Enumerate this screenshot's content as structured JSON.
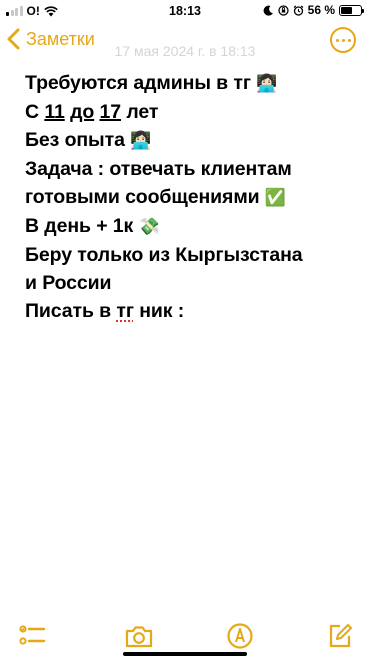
{
  "status_bar": {
    "carrier": "O!",
    "time": "18:13",
    "battery": "56 %",
    "battery_level": 0.56
  },
  "nav": {
    "back_label": "Заметки",
    "note_date": "17 мая 2024 г. в 18:13"
  },
  "note": {
    "lines": [
      {
        "parts": [
          "Требуются админы в тг",
          "👩🏻‍💻"
        ]
      },
      {
        "parts": [
          "С",
          "11",
          "до",
          "17",
          "лет"
        ]
      },
      {
        "parts": [
          "Без опыта",
          "👩🏻‍💻"
        ]
      },
      {
        "parts": [
          "Задача : отвечать клиентам"
        ]
      },
      {
        "parts": [
          "готовыми сообщениями",
          "✅"
        ]
      },
      {
        "parts": [
          "В день + 1к",
          "💸"
        ]
      },
      {
        "parts": [
          "Беру только из Кыргызстана"
        ]
      },
      {
        "parts": [
          "и России"
        ]
      },
      {
        "parts": [
          "Писать в",
          "тг",
          "ник :"
        ]
      }
    ]
  },
  "colors": {
    "accent": "#e6a817",
    "date_gray": "#d5d5d5",
    "spellcheck": "#dd3333"
  },
  "toolbar": {
    "icons": [
      "checklist-icon",
      "camera-icon",
      "markup-icon",
      "compose-icon"
    ]
  }
}
